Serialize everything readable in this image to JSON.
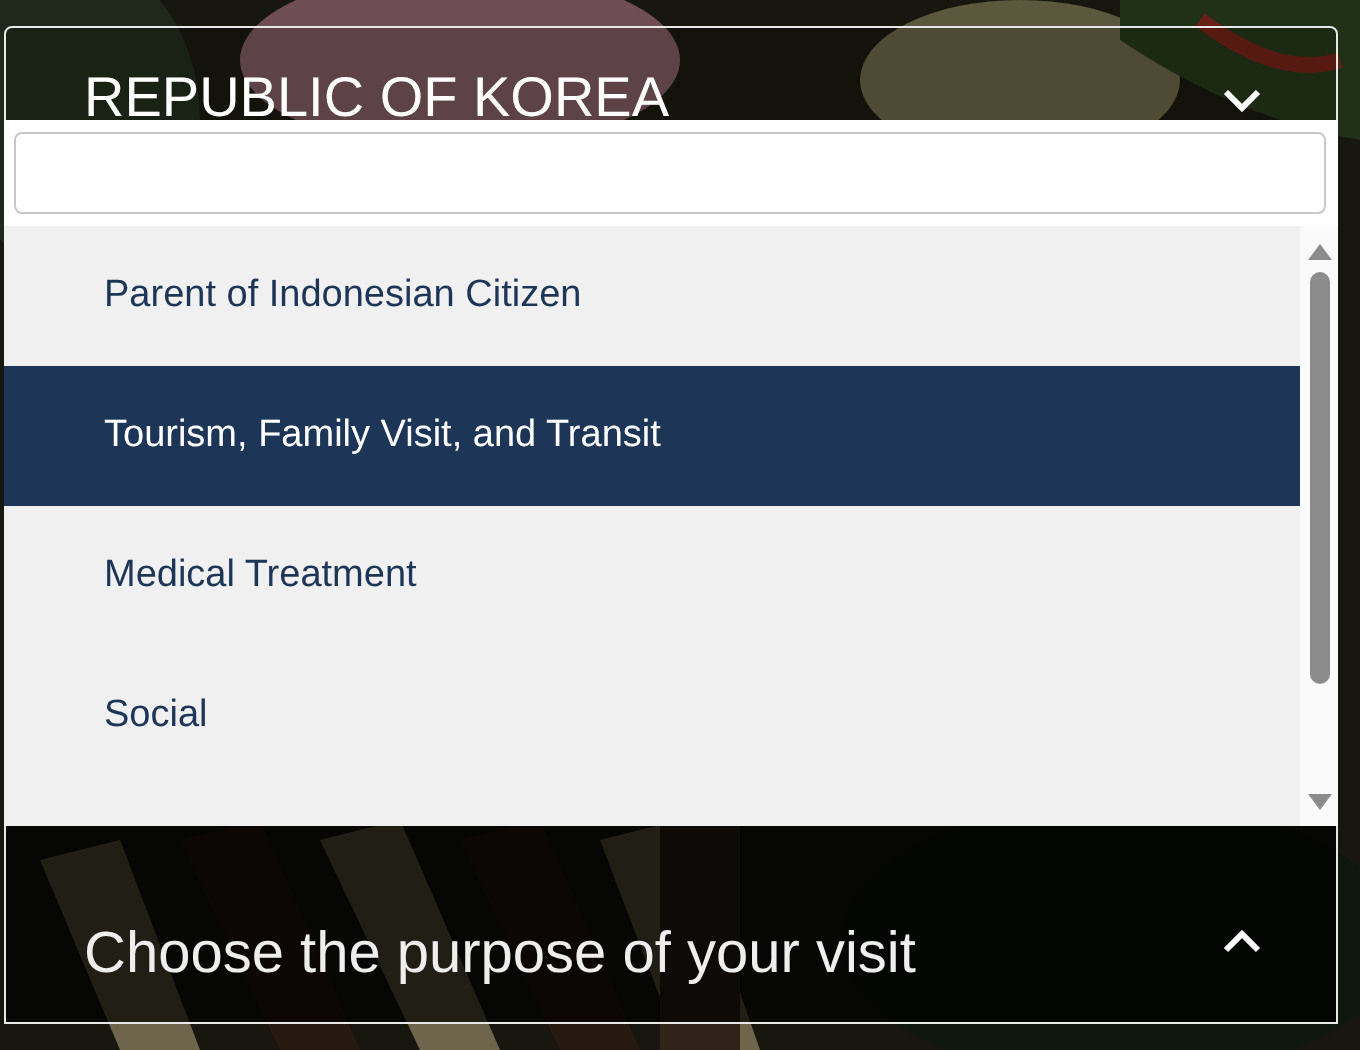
{
  "country_select": {
    "value": "REPUBLIC OF KOREA",
    "expanded": false
  },
  "purpose_options": [
    {
      "label": "Parent of Indonesian Citizen",
      "selected": false
    },
    {
      "label": "Tourism, Family Visit, and Transit",
      "selected": true
    },
    {
      "label": "Medical Treatment",
      "selected": false
    },
    {
      "label": "Social",
      "selected": false
    }
  ],
  "purpose_select": {
    "placeholder": "Choose the purpose of your visit",
    "expanded": true
  }
}
